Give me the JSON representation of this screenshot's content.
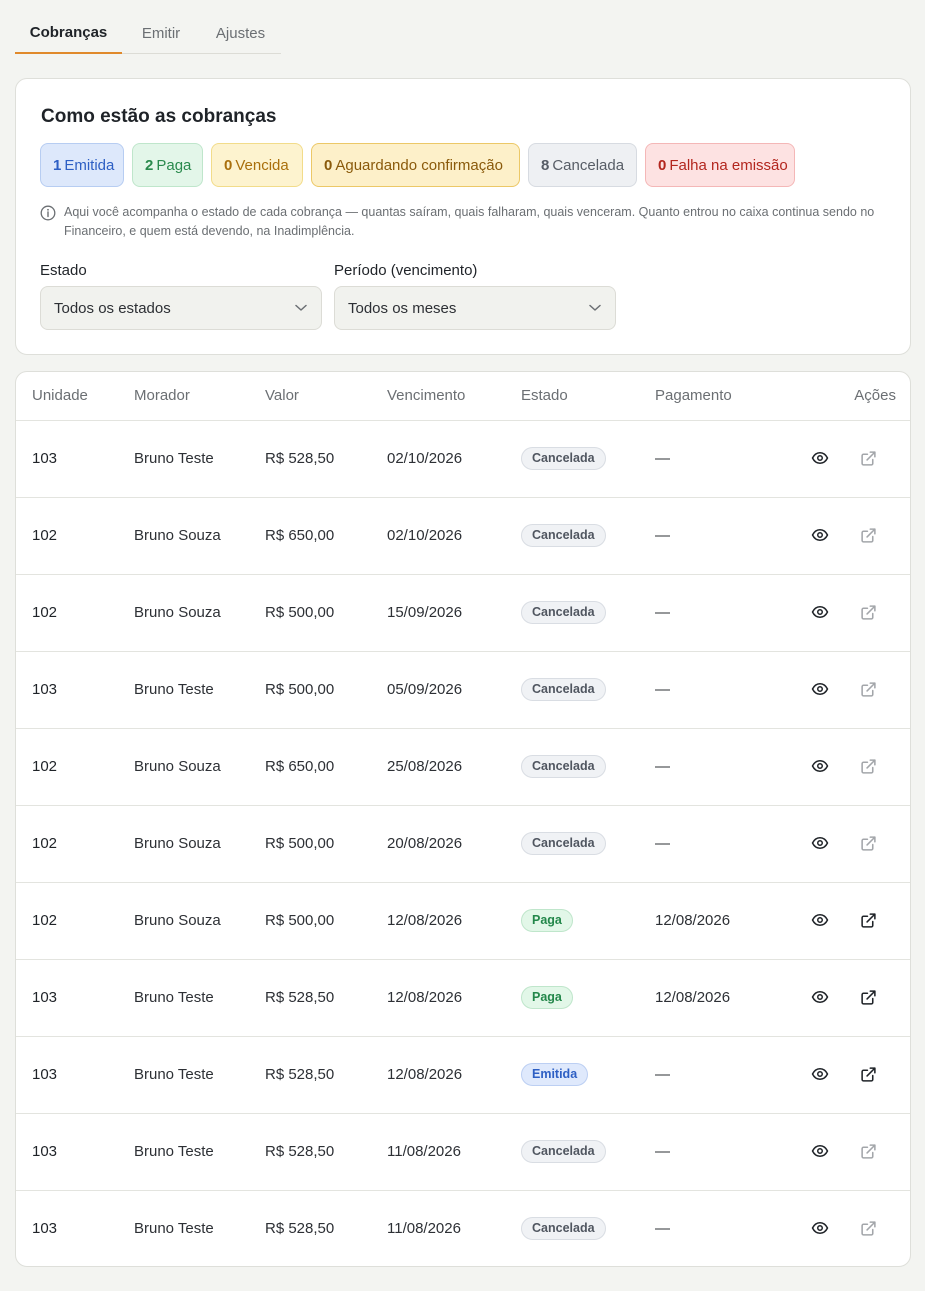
{
  "tabs": [
    {
      "label": "Cobranças"
    },
    {
      "label": "Emitir"
    },
    {
      "label": "Ajustes"
    }
  ],
  "summary": {
    "title": "Como estão as cobranças",
    "chips": [
      {
        "count": "1",
        "label": "Emitida"
      },
      {
        "count": "2",
        "label": "Paga"
      },
      {
        "count": "0",
        "label": "Vencida"
      },
      {
        "count": "0",
        "label": "Aguardando confirmação"
      },
      {
        "count": "8",
        "label": "Cancelada"
      },
      {
        "count": "0",
        "label": "Falha na emissão"
      }
    ],
    "info_text": "Aqui você acompanha o estado de cada cobrança — quantas saíram, quais falharam, quais venceram. Quanto entrou no caixa continua sendo no Financeiro, e quem está devendo, na Inadimplência.",
    "filters": {
      "estado_label": "Estado",
      "estado_value": "Todos os estados",
      "periodo_label": "Período (vencimento)",
      "periodo_value": "Todos os meses"
    }
  },
  "table": {
    "headers": [
      "Unidade",
      "Morador",
      "Valor",
      "Vencimento",
      "Estado",
      "Pagamento",
      "Ações"
    ],
    "rows": [
      {
        "unidade": "103",
        "morador": "Bruno Teste",
        "valor": "R$ 528,50",
        "vencimento": "02/10/2026",
        "estado": "Cancelada",
        "pagamento": "—"
      },
      {
        "unidade": "102",
        "morador": "Bruno Souza",
        "valor": "R$ 650,00",
        "vencimento": "02/10/2026",
        "estado": "Cancelada",
        "pagamento": "—"
      },
      {
        "unidade": "102",
        "morador": "Bruno Souza",
        "valor": "R$ 500,00",
        "vencimento": "15/09/2026",
        "estado": "Cancelada",
        "pagamento": "—"
      },
      {
        "unidade": "103",
        "morador": "Bruno Teste",
        "valor": "R$ 500,00",
        "vencimento": "05/09/2026",
        "estado": "Cancelada",
        "pagamento": "—"
      },
      {
        "unidade": "102",
        "morador": "Bruno Souza",
        "valor": "R$ 650,00",
        "vencimento": "25/08/2026",
        "estado": "Cancelada",
        "pagamento": "—"
      },
      {
        "unidade": "102",
        "morador": "Bruno Souza",
        "valor": "R$ 500,00",
        "vencimento": "20/08/2026",
        "estado": "Cancelada",
        "pagamento": "—"
      },
      {
        "unidade": "102",
        "morador": "Bruno Souza",
        "valor": "R$ 500,00",
        "vencimento": "12/08/2026",
        "estado": "Paga",
        "pagamento": "12/08/2026"
      },
      {
        "unidade": "103",
        "morador": "Bruno Teste",
        "valor": "R$ 528,50",
        "vencimento": "12/08/2026",
        "estado": "Paga",
        "pagamento": "12/08/2026"
      },
      {
        "unidade": "103",
        "morador": "Bruno Teste",
        "valor": "R$ 528,50",
        "vencimento": "12/08/2026",
        "estado": "Emitida",
        "pagamento": "—"
      },
      {
        "unidade": "103",
        "morador": "Bruno Teste",
        "valor": "R$ 528,50",
        "vencimento": "11/08/2026",
        "estado": "Cancelada",
        "pagamento": "—"
      },
      {
        "unidade": "103",
        "morador": "Bruno Teste",
        "valor": "R$ 528,50",
        "vencimento": "11/08/2026",
        "estado": "Cancelada",
        "pagamento": "—"
      }
    ]
  },
  "icons": {
    "view": "eye-icon",
    "open": "external-link-icon",
    "info": "info-icon",
    "select": "chevron-down-icon"
  },
  "colors": {
    "accent": "#e0892b",
    "emitida": "#2d5fc4",
    "paga": "#2a8a4d",
    "vencida": "#a96f0b",
    "cancelada": "#575d66",
    "falha": "#b3261e"
  }
}
